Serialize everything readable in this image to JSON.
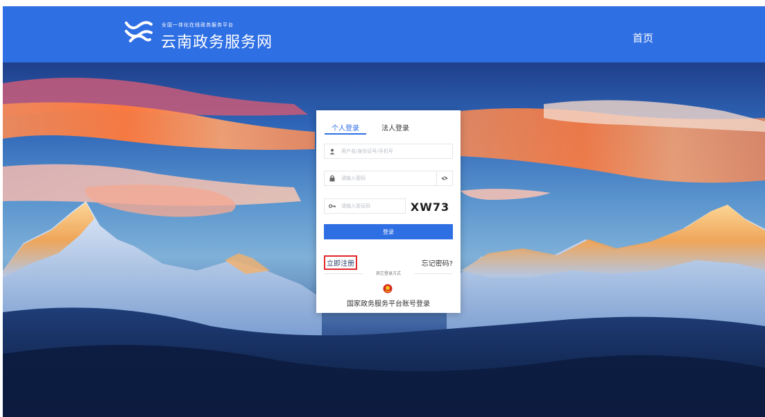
{
  "header": {
    "slogan": "全国一体化在线政务服务平台",
    "site_title": "云南政务服务网",
    "nav_home": "首页",
    "logo_icon": "wave-logo-icon",
    "bg_color": "#2f6fe4"
  },
  "login": {
    "tabs": [
      {
        "label": "个人登录",
        "active": true
      },
      {
        "label": "法人登录",
        "active": false
      }
    ],
    "username": {
      "placeholder": "用户名/身份证号/手机号",
      "value": "",
      "icon": "user-icon"
    },
    "password": {
      "placeholder": "请输入密码",
      "value": "",
      "icon": "lock-icon",
      "toggle_icon": "eye-icon"
    },
    "captcha": {
      "placeholder": "请输入验证码",
      "value": "",
      "icon": "key-icon",
      "image_text": "XW73"
    },
    "submit_label": "登录",
    "register_label": "立即注册",
    "forgot_label": "忘记密码?",
    "other_methods_label": "其它登录方式",
    "national_login_label": "国家政务服务平台账号登录",
    "national_icon": "national-emblem-icon",
    "accent_color": "#2f6fe4",
    "highlight_color": "#e0262a"
  }
}
